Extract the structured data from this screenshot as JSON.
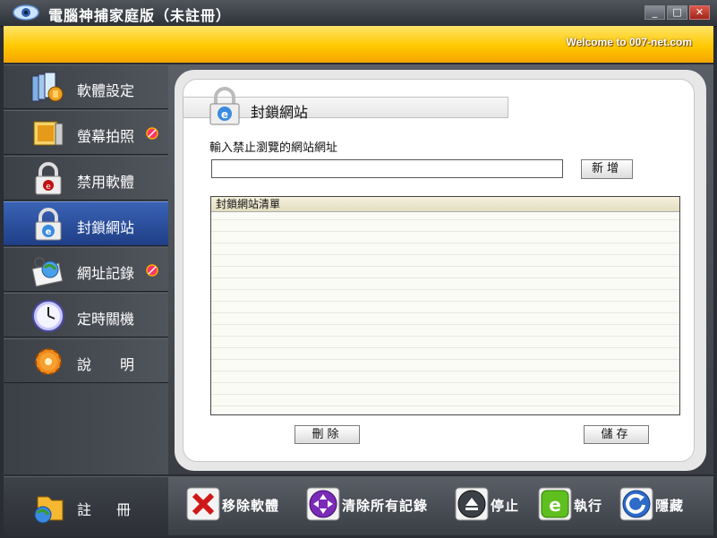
{
  "window": {
    "title": "電腦神捕家庭版（未註冊）",
    "controls": [
      "_",
      "□",
      "✕"
    ]
  },
  "banner": {
    "text": "Welcome to 007-net.com"
  },
  "sidebar": {
    "items": [
      {
        "label": "軟體設定",
        "icon": "software-settings-icon",
        "badge": false
      },
      {
        "label": "螢幕拍照",
        "icon": "screen-capture-icon",
        "badge": true
      },
      {
        "label": "禁用軟體",
        "icon": "lock-app-icon",
        "badge": false
      },
      {
        "label": "封鎖網站",
        "icon": "lock-ie-icon",
        "badge": false,
        "active": true
      },
      {
        "label": "網址記錄",
        "icon": "url-history-icon",
        "badge": true
      },
      {
        "label": "定時關機",
        "icon": "clock-icon",
        "badge": false
      },
      {
        "label": "說　　明",
        "icon": "gear-icon",
        "badge": false
      }
    ],
    "register_label": "註冊"
  },
  "section": {
    "title": "封鎖網站",
    "input_label": "輸入禁止瀏覽的網站網址",
    "url_value": "",
    "url_placeholder": "",
    "add_button": "新增",
    "list_header": "封鎖網站清單",
    "list_items": [],
    "delete_button": "刪除",
    "save_button": "儲存"
  },
  "actions": [
    {
      "label": "移除軟體",
      "icon": "red-x-icon"
    },
    {
      "label": "清除所有記錄",
      "icon": "purple-clear-icon"
    },
    {
      "label": "停止",
      "icon": "eject-icon"
    },
    {
      "label": "執行",
      "icon": "green-run-icon"
    },
    {
      "label": "隱藏",
      "icon": "blue-hide-icon"
    }
  ],
  "colors": {
    "banner": "#ffc800",
    "active_nav": "#2b4f9e",
    "sidebar": "#43474e"
  }
}
